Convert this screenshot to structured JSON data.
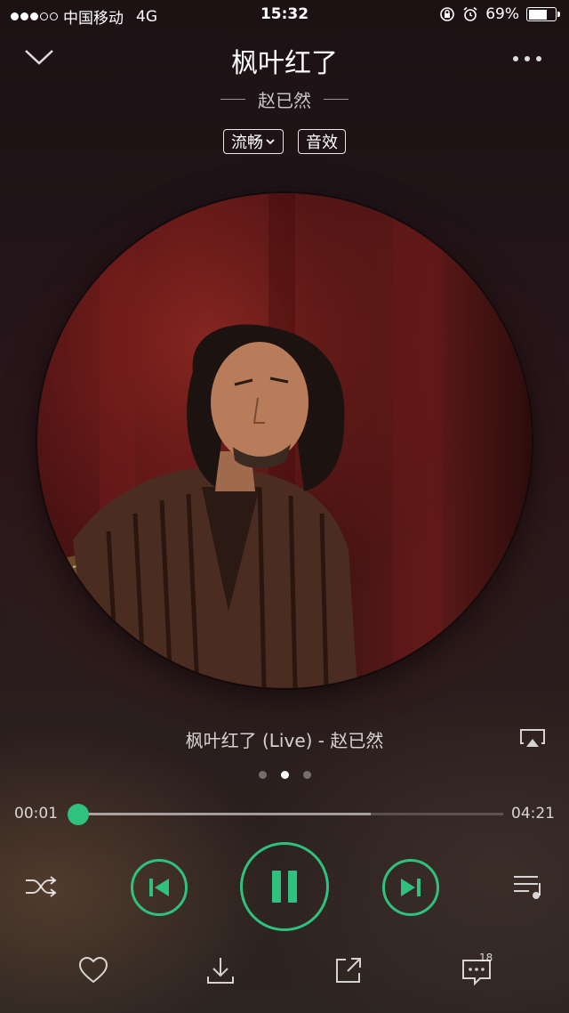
{
  "status": {
    "carrier": "中国移动",
    "network": "4G",
    "time": "15:32",
    "battery": "69%",
    "battery_level": 0.69
  },
  "header": {
    "title": "枫叶红了",
    "artist": "赵已然",
    "quality_label": "流畅",
    "effect_label": "音效"
  },
  "now_playing": {
    "song_line": "枫叶红了 (Live) - 赵已然",
    "pages": 3,
    "active_page": 1
  },
  "progress": {
    "current": "00:01",
    "total": "04:21",
    "played_fraction": 0.004,
    "buffered_fraction": 0.69
  },
  "actions": {
    "comment_count": "18"
  },
  "colors": {
    "accent": "#2ec27e"
  },
  "icons": [
    "chevron-down-icon",
    "more-icon",
    "airplay-icon",
    "shuffle-icon",
    "previous-icon",
    "pause-icon",
    "next-icon",
    "playlist-icon",
    "heart-icon",
    "download-icon",
    "share-icon",
    "comment-icon"
  ]
}
